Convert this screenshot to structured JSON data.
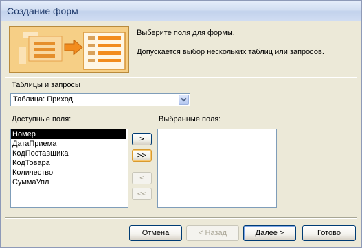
{
  "window": {
    "title": "Создание форм"
  },
  "instructions": {
    "line1": "Выберите поля для формы.",
    "line2": "Допускается выбор нескольких таблиц или запросов."
  },
  "tables": {
    "label_accel": "Т",
    "label_rest": "аблицы и запросы",
    "selected_value": "Таблица: Приход"
  },
  "available_fields": {
    "label": "Доступные поля:",
    "items": [
      "Номер",
      "ДатаПриема",
      "КодПоставщика",
      "КодТовара",
      "Количество",
      "СуммаУпл"
    ],
    "selected_index": 0
  },
  "selected_fields": {
    "label": "Выбранные поля:",
    "items": []
  },
  "move_buttons": {
    "add_one": ">",
    "add_all": ">>",
    "remove_one": "<",
    "remove_all": "<<"
  },
  "footer": {
    "cancel": "Отмена",
    "back": "< Назад",
    "next": "Далее >",
    "finish": "Готово"
  },
  "colors": {
    "title_text": "#1f3a6b",
    "dialog_bg": "#ece9d8",
    "illustration_bg": "#f6d08a",
    "illustration_accent": "#f28c1e"
  },
  "icons": {
    "combo_arrow": "chevron-down-icon",
    "illustration": "wizard-fields-illustration"
  }
}
